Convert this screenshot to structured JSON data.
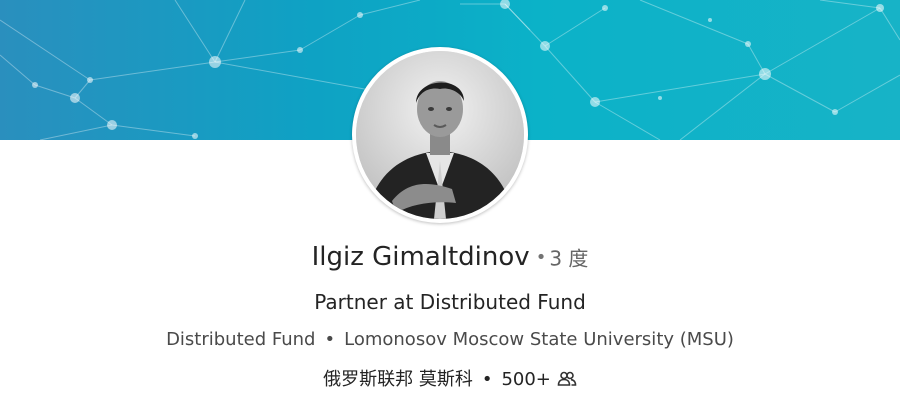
{
  "profile": {
    "name": "Ilgiz Gimaltdinov",
    "separator": "•",
    "degree": "3 度",
    "headline": "Partner at Distributed Fund",
    "company": "Distributed Fund",
    "education": "Lomonosov Moscow State University (MSU)",
    "location": "俄罗斯联邦 莫斯科",
    "connections": "500+",
    "connections_icon": "people-icon",
    "avatar_icon": "profile-photo"
  },
  "colors": {
    "banner_start": "#2a8fbe",
    "banner_end": "#17b3c7",
    "text_primary": "#242424",
    "text_secondary": "#4a4a4a"
  }
}
